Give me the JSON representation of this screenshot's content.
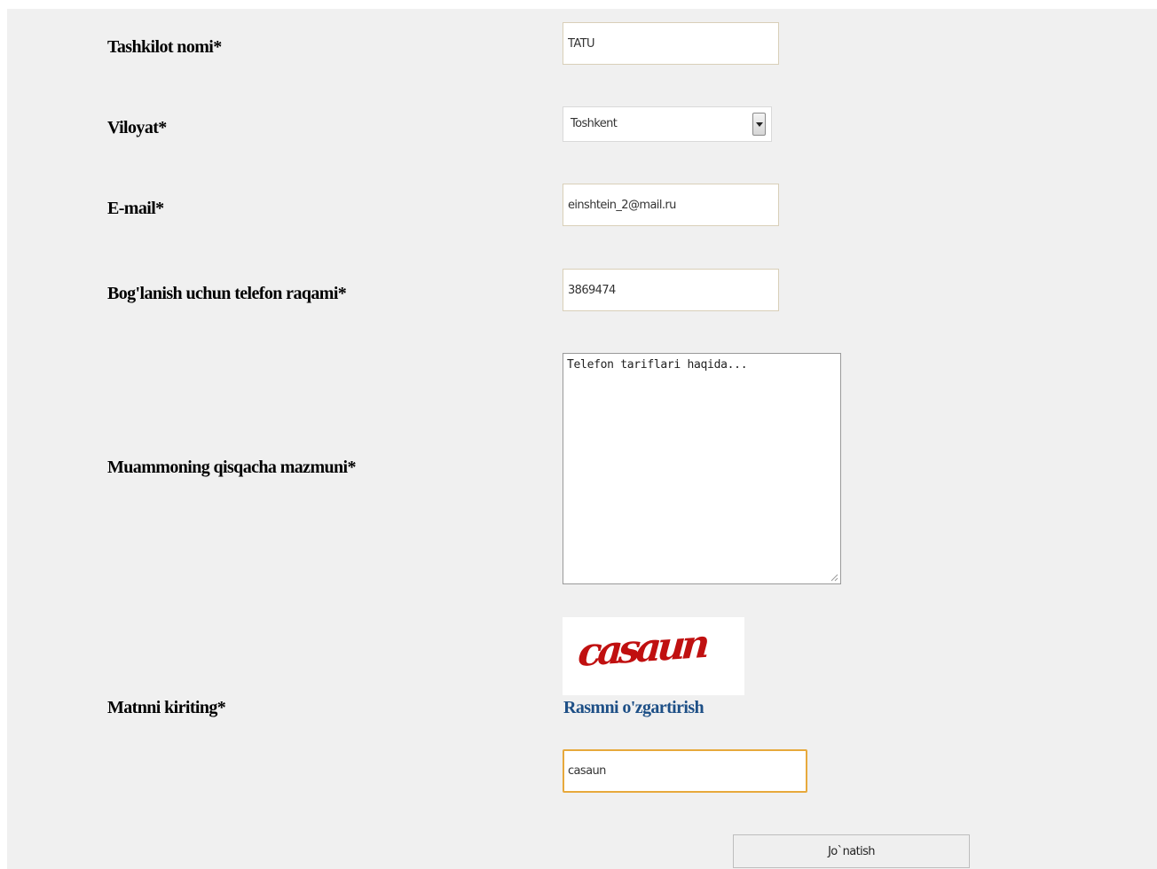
{
  "form": {
    "organization": {
      "label": "Tashkilot nomi*",
      "value": "TATU"
    },
    "region": {
      "label": "Viloyat*",
      "selected": "Toshkent"
    },
    "email": {
      "label": "E-mail*",
      "value": "einshtein_2@mail.ru"
    },
    "phone": {
      "label": "Bog'lanish uchun telefon raqami*",
      "value": "3869474"
    },
    "problem": {
      "label": "Muammoning qisqacha mazmuni*",
      "value": "Telefon tariflari haqida..."
    },
    "captcha": {
      "label": "Matnni kiriting*",
      "image_text": "casaun",
      "change_link": "Rasmni o'zgartirish",
      "value": "casaun"
    },
    "submit_label": "Jo`natish"
  },
  "colors": {
    "panel_background": "#f0f0f0",
    "link": "#1d4f86",
    "captcha_text": "#c01010",
    "focus_border": "#e7a93c"
  },
  "icons": {
    "select_arrow": "chevron-down-icon",
    "textarea_grip": "resize-grip-icon"
  }
}
